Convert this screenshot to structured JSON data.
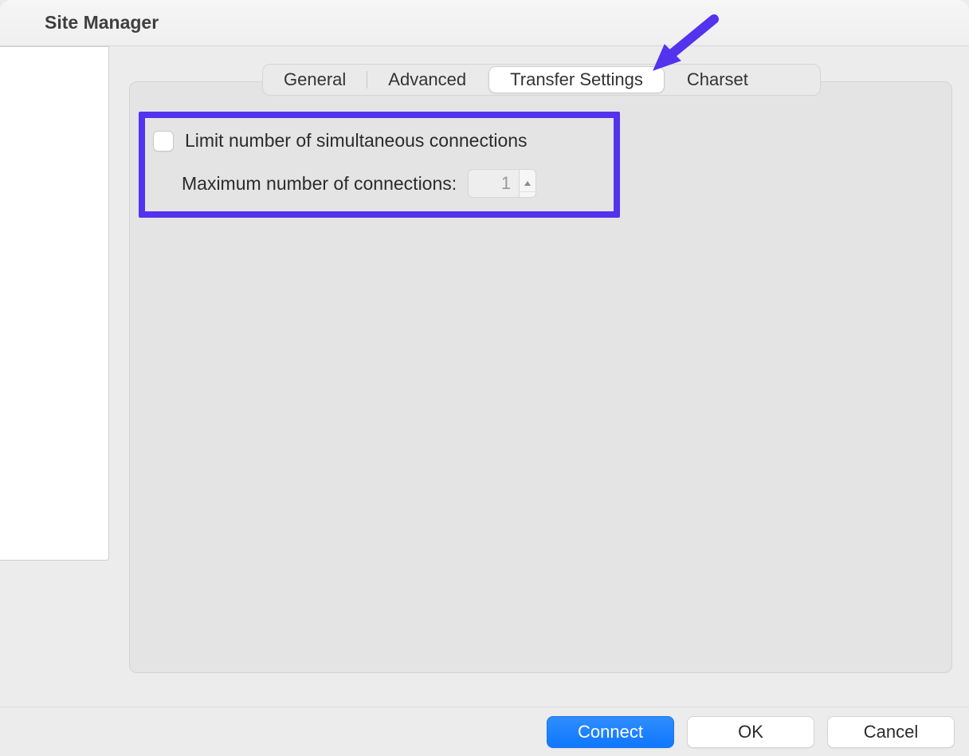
{
  "window": {
    "title": "Site Manager"
  },
  "tabs": {
    "general": "General",
    "advanced": "Advanced",
    "transfer_settings": "Transfer Settings",
    "charset": "Charset",
    "active": "transfer_settings"
  },
  "settings": {
    "limit_label": "Limit number of simultaneous connections",
    "limit_checked": false,
    "max_label": "Maximum number of connections:",
    "max_value": "1"
  },
  "buttons": {
    "connect": "Connect",
    "ok": "OK",
    "cancel": "Cancel"
  },
  "annotation": {
    "arrow_color": "#5333ed",
    "highlight_color": "#5333ed"
  }
}
